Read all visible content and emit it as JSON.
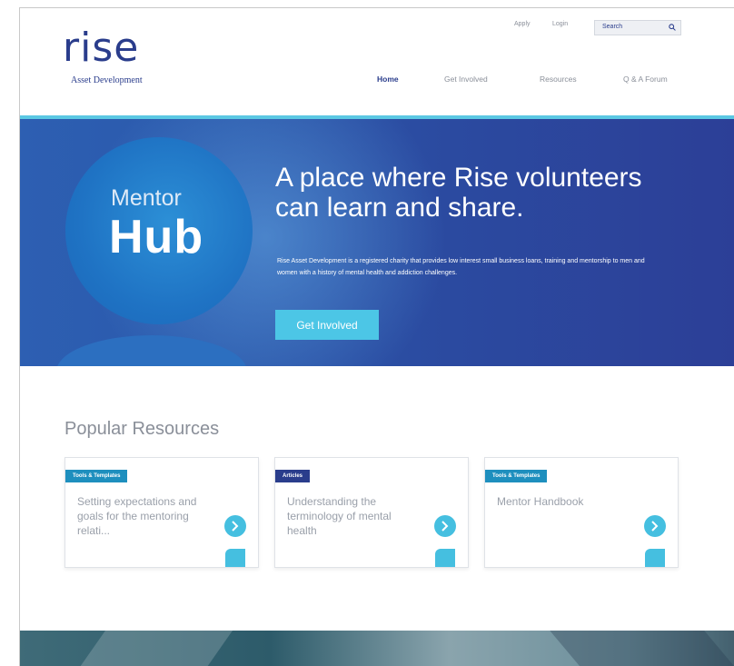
{
  "brand": {
    "logo_word": "rise",
    "logo_sub": "Asset Development",
    "primary": "#2a3d8c",
    "accent": "#4cc6e6"
  },
  "utility": {
    "apply": "Apply",
    "login": "Login",
    "search_label": "Search"
  },
  "nav": {
    "home": "Home",
    "get_involved": "Get Involved",
    "resources": "Resources",
    "forum": "Q & A Forum"
  },
  "hero": {
    "mentor": "Mentor",
    "hub": "Hub",
    "title": "A place where Rise volunteers can learn and share.",
    "description": "Rise Asset Development is a registered charity that provides low interest small business loans, training and mentorship to men and women with a history of mental health and addiction challenges.",
    "cta": "Get Involved"
  },
  "resources": {
    "heading": "Popular Resources",
    "cards": [
      {
        "tag": "Tools & Templates",
        "title": "Setting expectations and goals for the mentoring relati..."
      },
      {
        "tag": "Articles",
        "title": "Understanding the terminology of mental health"
      },
      {
        "tag": "Tools & Templates",
        "title": "Mentor Handbook"
      }
    ]
  }
}
